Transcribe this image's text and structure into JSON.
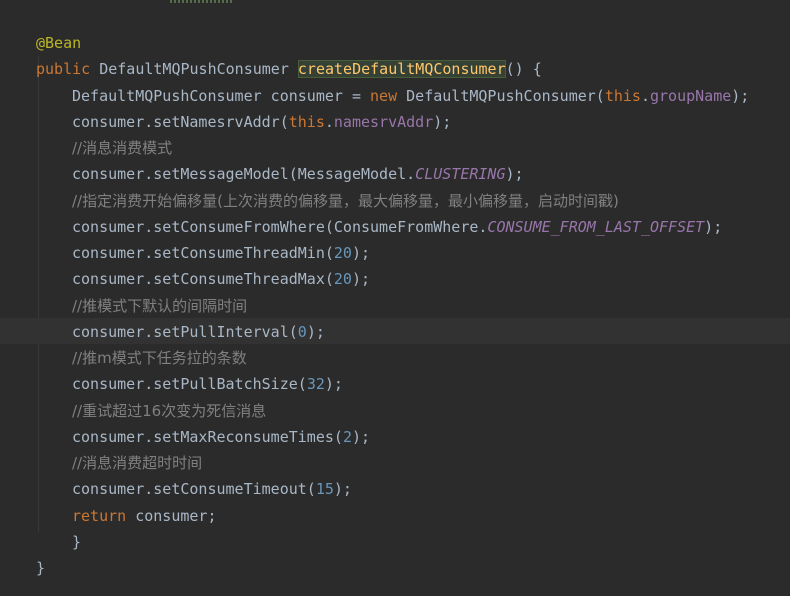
{
  "editor": {
    "lines": [
      {
        "p": [
          {
            "t": "@Bean",
            "c": "ann"
          }
        ]
      },
      {
        "p": [
          {
            "t": "public ",
            "c": "kw"
          },
          {
            "t": "DefaultMQPushConsumer ",
            "c": ""
          },
          {
            "t": "createDefaultMQConsumer",
            "c": "fn hl"
          },
          {
            "t": "() {",
            "c": ""
          }
        ]
      },
      {
        "p": [
          {
            "t": "DefaultMQPushConsumer consumer = ",
            "c": ""
          },
          {
            "t": "new ",
            "c": "kw"
          },
          {
            "t": "DefaultMQPushConsumer(",
            "c": ""
          },
          {
            "t": "this",
            "c": "kw"
          },
          {
            "t": ".",
            "c": ""
          },
          {
            "t": "groupName",
            "c": "fld"
          },
          {
            "t": ");",
            "c": ""
          }
        ]
      },
      {
        "p": [
          {
            "t": "consumer.setNamesrvAddr(",
            "c": ""
          },
          {
            "t": "this",
            "c": "kw"
          },
          {
            "t": ".",
            "c": ""
          },
          {
            "t": "namesrvAddr",
            "c": "fld"
          },
          {
            "t": ");",
            "c": ""
          }
        ]
      },
      {
        "p": [
          {
            "t": "//消息消费模式",
            "c": "cmt"
          }
        ]
      },
      {
        "p": [
          {
            "t": "consumer.setMessageModel(MessageModel.",
            "c": ""
          },
          {
            "t": "CLUSTERING",
            "c": "cst"
          },
          {
            "t": ");",
            "c": ""
          }
        ]
      },
      {
        "p": [
          {
            "t": "//指定消费开始偏移量(上次消费的偏移量，最大偏移量，最小偏移量，启动时间戳)",
            "c": "cmt"
          }
        ]
      },
      {
        "p": [
          {
            "t": "consumer.setConsumeFromWhere(ConsumeFromWhere.",
            "c": ""
          },
          {
            "t": "CONSUME_FROM_LAST_OFFSET",
            "c": "cst"
          },
          {
            "t": ");",
            "c": ""
          }
        ]
      },
      {
        "p": [
          {
            "t": "consumer.setConsumeThreadMin(",
            "c": ""
          },
          {
            "t": "20",
            "c": "num"
          },
          {
            "t": ");",
            "c": ""
          }
        ]
      },
      {
        "p": [
          {
            "t": "consumer.setConsumeThreadMax(",
            "c": ""
          },
          {
            "t": "20",
            "c": "num"
          },
          {
            "t": ");",
            "c": ""
          }
        ]
      },
      {
        "p": [
          {
            "t": "//推模式下默认的间隔时间",
            "c": "cmt"
          }
        ]
      },
      {
        "p": [
          {
            "t": "consumer.setPullInterval(",
            "c": ""
          },
          {
            "t": "0",
            "c": "num"
          },
          {
            "t": ");",
            "c": ""
          }
        ]
      },
      {
        "p": [
          {
            "t": "//推m模式下任务拉的条数",
            "c": "cmt"
          }
        ]
      },
      {
        "p": [
          {
            "t": "consumer.setPullBatchSize(",
            "c": ""
          },
          {
            "t": "32",
            "c": "num"
          },
          {
            "t": ");",
            "c": ""
          }
        ]
      },
      {
        "p": [
          {
            "t": "//重试超过16次变为死信消息",
            "c": "cmt"
          }
        ]
      },
      {
        "p": [
          {
            "t": "consumer.setMaxReconsumeTimes(",
            "c": ""
          },
          {
            "t": "2",
            "c": "num"
          },
          {
            "t": ");",
            "c": ""
          }
        ]
      },
      {
        "p": [
          {
            "t": "//消息消费超时时间",
            "c": "cmt"
          }
        ]
      },
      {
        "p": [
          {
            "t": "consumer.setConsumeTimeout(",
            "c": ""
          },
          {
            "t": "15",
            "c": "num"
          },
          {
            "t": ");",
            "c": ""
          }
        ]
      },
      {
        "p": [
          {
            "t": "return ",
            "c": "kw"
          },
          {
            "t": "consumer;",
            "c": ""
          }
        ]
      },
      {
        "p": [
          {
            "t": "}",
            "c": ""
          }
        ]
      },
      {
        "p": [
          {
            "t": "}",
            "c": ""
          }
        ]
      }
    ]
  },
  "colors": {
    "background": "#2b2b2b",
    "text": "#a9b7c6",
    "keyword": "#cc7832",
    "annotation": "#bbb529",
    "field": "#9876aa",
    "number": "#6897bb",
    "comment": "#808080",
    "method": "#ffc66d",
    "caret_line": "#323232"
  }
}
